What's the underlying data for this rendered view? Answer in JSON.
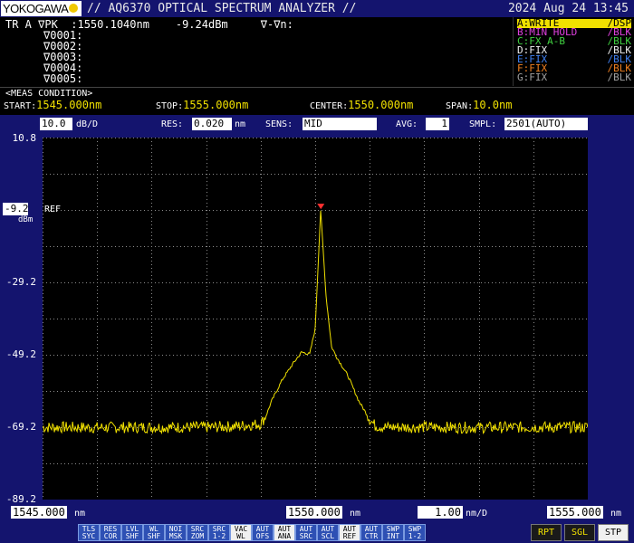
{
  "app": {
    "logo": "YOKOGAWA",
    "title": "// AQ6370 OPTICAL SPECTRUM ANALYZER //",
    "datetime": "2024 Aug 24 13:45"
  },
  "header": {
    "trace_line": "TR A ∇PK  :1550.1040nm    -9.24dBm     ∇-∇n:",
    "markers": [
      "∇0001:",
      "∇0002:",
      "∇0003:",
      "∇0004:",
      "∇0005:"
    ]
  },
  "legend": [
    {
      "name": "A:WRITE",
      "mode": "/DSP",
      "color": "#f0e000",
      "highlight": true
    },
    {
      "name": "B:MIN HOLD",
      "mode": "/BLK",
      "color": "#e040e0",
      "highlight": false
    },
    {
      "name": "C:FX A-B",
      "mode": "/BLK",
      "color": "#40d040",
      "highlight": false
    },
    {
      "name": "D:FIX",
      "mode": "/BLK",
      "color": "#f0f0f0",
      "highlight": false
    },
    {
      "name": "E:FIX",
      "mode": "/BLK",
      "color": "#4080f0",
      "highlight": false
    },
    {
      "name": "F:FIX",
      "mode": "/BLK",
      "color": "#f08020",
      "highlight": false
    },
    {
      "name": "G:FIX",
      "mode": "/BLK",
      "color": "#a0a0a0",
      "highlight": false
    }
  ],
  "meas": {
    "title": "<MEAS CONDITION>",
    "start_label": "START:",
    "start": "1545.000nm",
    "stop_label": "STOP:",
    "stop": "1555.000nm",
    "center_label": "CENTER:",
    "center": "1550.000nm",
    "span_label": "SPAN:",
    "span": "10.0nm"
  },
  "settings": {
    "scale_value": "10.0",
    "scale_unit": "dB/D",
    "res_label": "RES:",
    "res_value": "0.020",
    "res_unit": "nm",
    "sens_label": "SENS:",
    "sens_value": "MID",
    "avg_label": "AVG:",
    "avg_value": "1",
    "smpl_label": "SMPL:",
    "smpl_value": "2501(AUTO)"
  },
  "yaxis": {
    "ref_value": "-9.2",
    "ref_label": "REF",
    "ref_unit": "dBm",
    "ticks": [
      "10.8",
      "-29.2",
      "-49.2",
      "-69.2",
      "-89.2"
    ]
  },
  "xaxis": {
    "start": "1545.000",
    "center": "1550.000",
    "stop": "1555.000",
    "unit": "nm",
    "per_div": "1.00",
    "per_div_unit": "nm/D"
  },
  "softkeys": [
    {
      "l1": "TLS",
      "l2": "SYC",
      "on": false
    },
    {
      "l1": "RES",
      "l2": "COR",
      "on": false
    },
    {
      "l1": "LVL",
      "l2": "SHF",
      "on": false
    },
    {
      "l1": "WL",
      "l2": "SHF",
      "on": false
    },
    {
      "l1": "NOI",
      "l2": "MSK",
      "on": false
    },
    {
      "l1": "SRC",
      "l2": "ZOM",
      "on": false
    },
    {
      "l1": "SRC",
      "l2": "1-2",
      "on": false
    },
    {
      "l1": "VAC",
      "l2": "WL",
      "on": true
    },
    {
      "l1": "AUT",
      "l2": "OFS",
      "on": false
    },
    {
      "l1": "AUT",
      "l2": "ANA",
      "on": true
    },
    {
      "l1": "AUT",
      "l2": "SRC",
      "on": false
    },
    {
      "l1": "AUT",
      "l2": "SCL",
      "on": false
    },
    {
      "l1": "AUT",
      "l2": "REF",
      "on": true
    },
    {
      "l1": "AUT",
      "l2": "CTR",
      "on": false
    },
    {
      "l1": "SWP",
      "l2": "INT",
      "on": false
    },
    {
      "l1": "SWP",
      "l2": "1-2",
      "on": false
    }
  ],
  "funckeys": [
    {
      "label": "RPT",
      "color": "#f0e000",
      "bg": "#1a1a1a"
    },
    {
      "label": "SGL",
      "color": "#f0e000",
      "bg": "#1a1a1a"
    },
    {
      "label": "STP",
      "color": "#000000",
      "bg": "#f0f0f0"
    }
  ],
  "chart_data": {
    "type": "line",
    "series": [
      {
        "color": "#f0e000",
        "x": [
          1545.0,
          1546.0,
          1547.0,
          1548.0,
          1548.5,
          1549.0,
          1549.1,
          1549.2,
          1549.4,
          1549.6,
          1549.75,
          1549.9,
          1550.0,
          1550.1,
          1550.2,
          1550.3,
          1550.4,
          1550.6,
          1550.8,
          1551.0,
          1551.1,
          1551.3,
          1552.0,
          1553.0,
          1554.0,
          1555.0
        ],
        "y": [
          -69.2,
          -69.3,
          -69.2,
          -69.2,
          -69.0,
          -68.3,
          -66.0,
          -62.0,
          -56.0,
          -51.5,
          -48.5,
          -49.0,
          -42.0,
          -9.24,
          -33.0,
          -47.0,
          -50.0,
          -55.0,
          -62.0,
          -67.0,
          -68.8,
          -69.2,
          -69.2,
          -69.3,
          -69.2,
          -69.2
        ]
      }
    ],
    "peak": {
      "x": 1550.104,
      "y": -9.24
    },
    "xlim": [
      1545.0,
      1555.0
    ],
    "ylim": [
      -89.2,
      10.8
    ],
    "x_ticks": [
      1545,
      1546,
      1547,
      1548,
      1549,
      1550,
      1551,
      1552,
      1553,
      1554,
      1555
    ],
    "y_ticks": [
      10.8,
      0.8,
      -9.2,
      -19.2,
      -29.2,
      -39.2,
      -49.2,
      -59.2,
      -69.2,
      -79.2,
      -89.2
    ],
    "grid": true
  }
}
